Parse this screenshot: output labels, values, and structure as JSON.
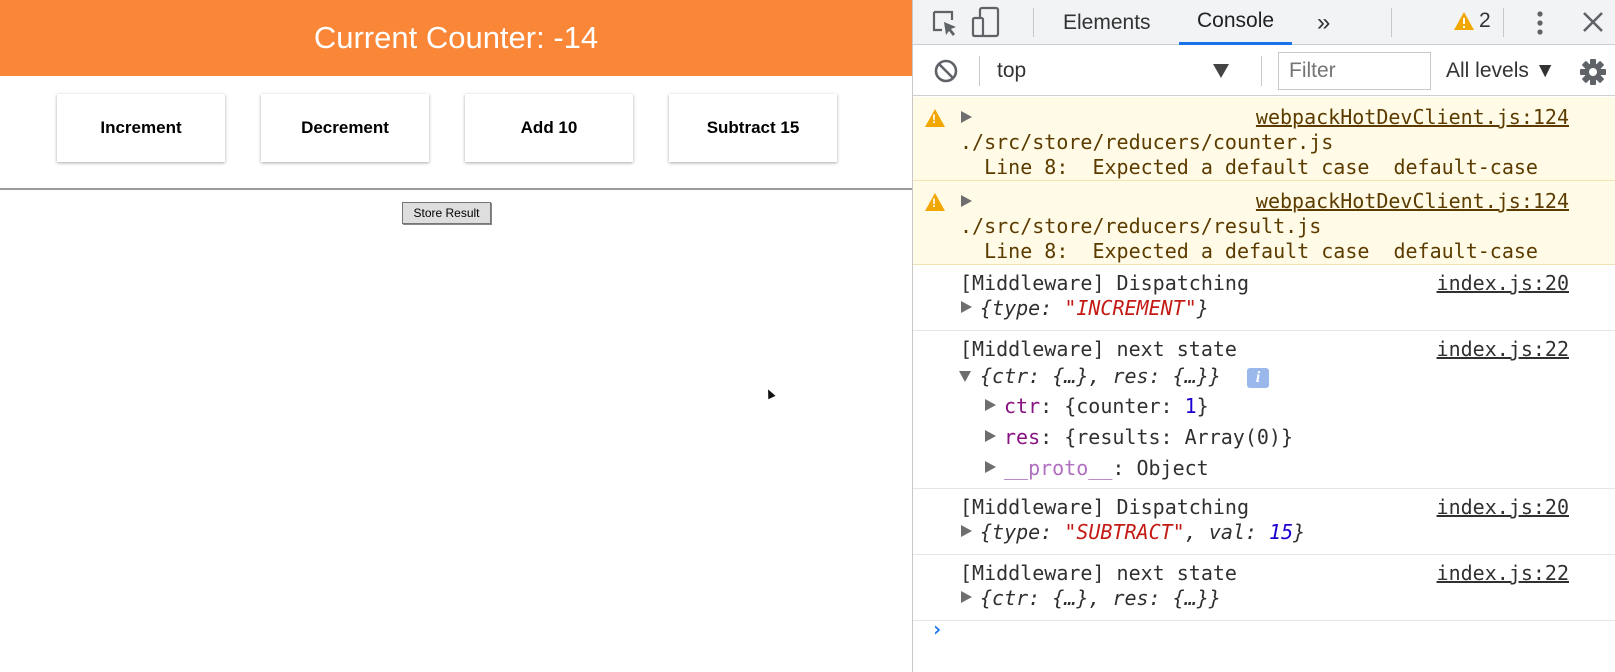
{
  "app": {
    "counter_text": "Current Counter: -14",
    "buttons": [
      "Increment",
      "Decrement",
      "Add 10",
      "Subtract 15"
    ],
    "store_result": "Store Result"
  },
  "devtools": {
    "tabs": {
      "elements": "Elements",
      "console": "Console",
      "more": "»"
    },
    "warnings_count": "2",
    "context": "top",
    "filter_placeholder": "Filter",
    "levels": "All levels ▼",
    "log": {
      "w1": {
        "src": "webpackHotDevClient.js:124",
        "file": "./src/store/reducers/counter.js",
        "msg": "  Line 8:  Expected a default case  default-case"
      },
      "w2": {
        "src": "webpackHotDevClient.js:124",
        "file": "./src/store/reducers/result.js",
        "msg": "  Line 8:  Expected a default case  default-case"
      },
      "e1": {
        "label": "[Middleware] Dispatching",
        "src": "index.js:20",
        "obj": {
          "open": "{",
          "key": "type",
          "sep": ": ",
          "val": "\"INCREMENT\"",
          "close": "}"
        }
      },
      "e2": {
        "label": "[Middleware] next state",
        "src": "index.js:22",
        "obj": "{ctr: {…}, res: {…}}",
        "ctr": {
          "key": "ctr",
          "rest": ": {counter: ",
          "num": "1",
          "close": "}"
        },
        "res": {
          "key": "res",
          "rest": ": {results: Array(0)}"
        },
        "proto": {
          "key": "__proto__",
          "rest": ": Object"
        }
      },
      "e3": {
        "label": "[Middleware] Dispatching",
        "src": "index.js:20",
        "obj": {
          "open": "{",
          "k1": "type",
          "s1": ": ",
          "v1": "\"SUBTRACT\"",
          "s2": ", ",
          "k2": "val",
          "s3": ": ",
          "v2": "15",
          "close": "}"
        }
      },
      "e4": {
        "label": "[Middleware] next state",
        "src": "index.js:22",
        "obj": "{ctr: {…}, res: {…}}"
      }
    },
    "prompt": "›",
    "colors": {
      "accent": "#1a73e8",
      "warning_bg": "#fffbe6",
      "warning_icon": "#f2a600",
      "string": "#c41a16",
      "number": "#1c00cf",
      "key": "#881280"
    }
  }
}
